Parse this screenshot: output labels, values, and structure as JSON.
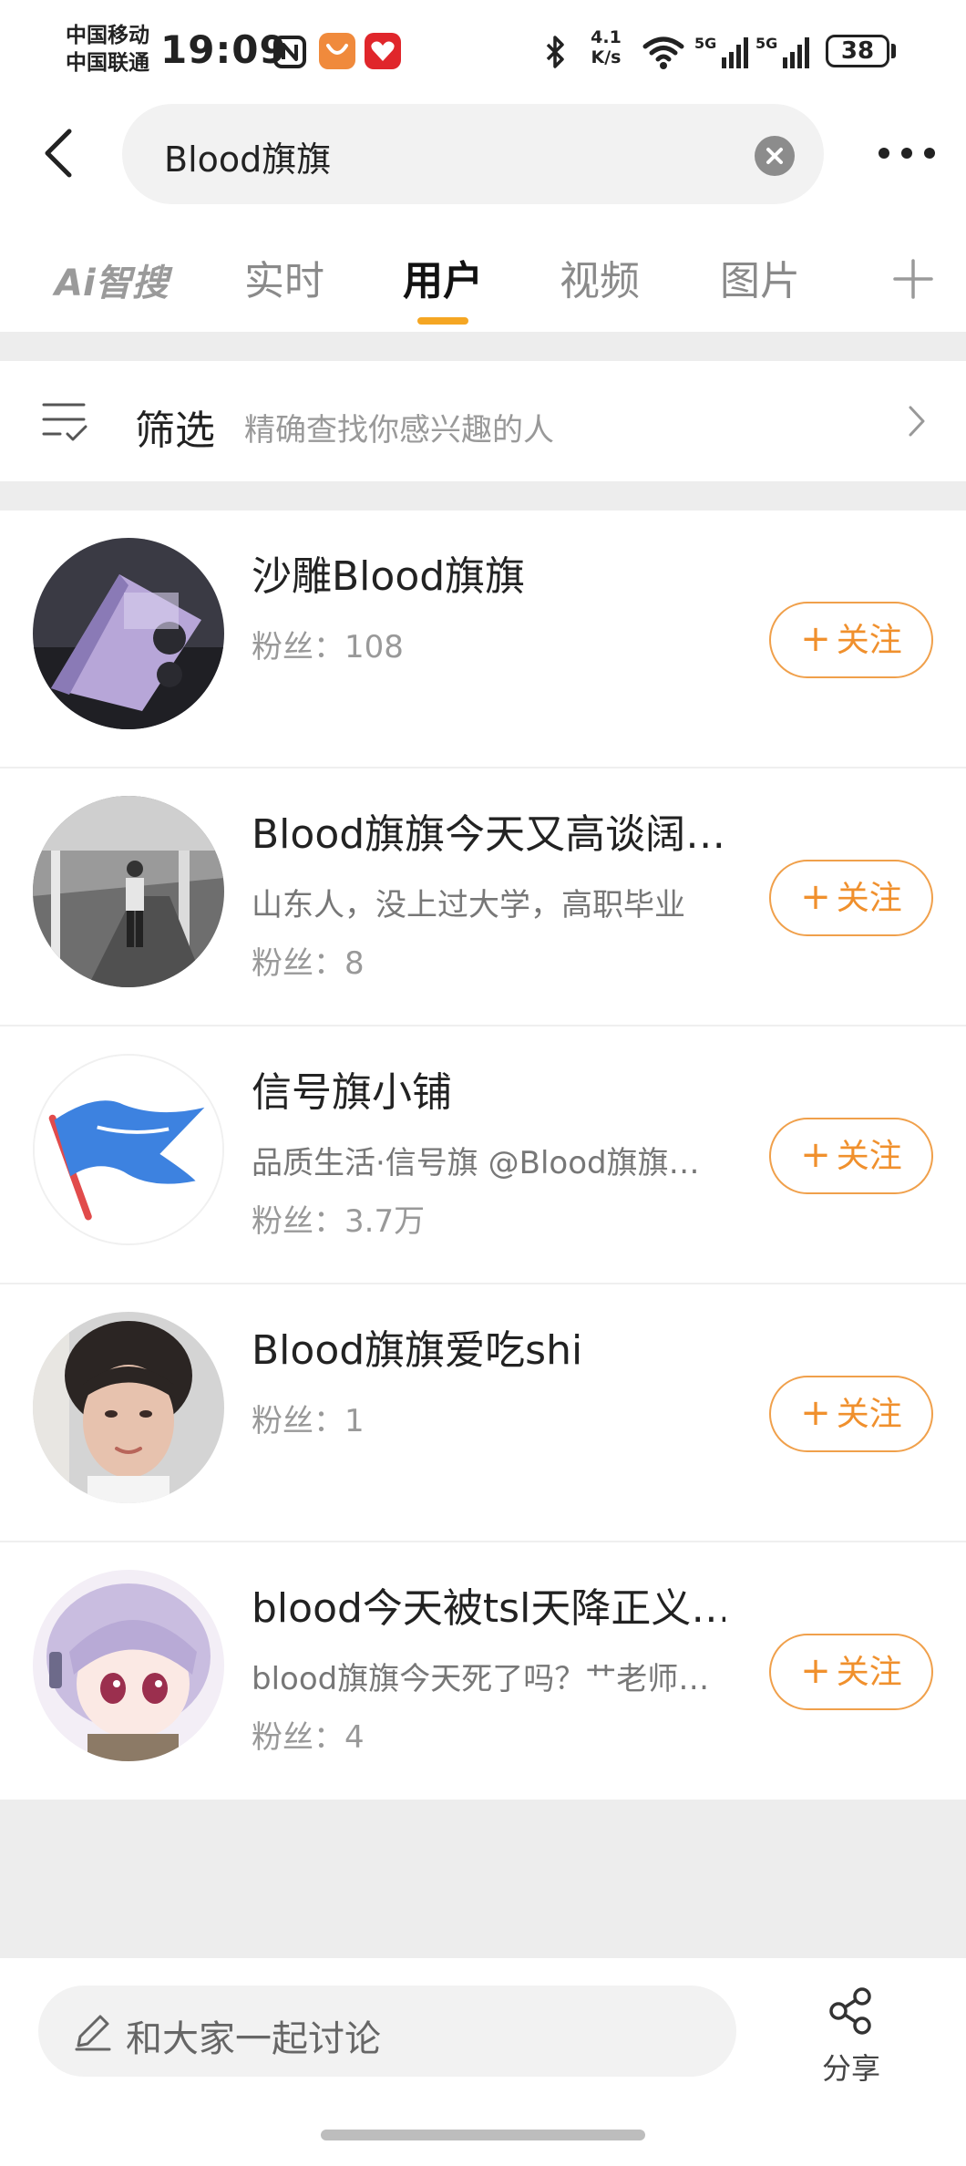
{
  "status_bar": {
    "carrier_1": "中国移动",
    "carrier_2": "中国联通",
    "time": "19:09",
    "net_speed_value": "4.1",
    "net_speed_unit": "K/s",
    "sig1_label": "5G",
    "sig2_label": "5G",
    "battery": "38"
  },
  "search": {
    "query": "Blood旗旗"
  },
  "tabs": [
    {
      "label": "Ai智搜"
    },
    {
      "label": "实时"
    },
    {
      "label": "用户"
    },
    {
      "label": "视频"
    },
    {
      "label": "图片"
    }
  ],
  "active_tab": "用户",
  "filter": {
    "title": "筛选",
    "description": "精确查找你感兴趣的人"
  },
  "users": [
    {
      "name": "沙雕Blood旗旗",
      "description": "",
      "fans_label": "粉丝：",
      "fans": "108",
      "follow_label": "关注"
    },
    {
      "name": "Blood旗旗今天又高谈阔…",
      "description": "山东人，没上过大学，高职毕业",
      "fans_label": "粉丝：",
      "fans": "8",
      "follow_label": "关注"
    },
    {
      "name": "信号旗小铺",
      "description": "品质生活·信号旗 @Blood旗旗…",
      "fans_label": "粉丝：",
      "fans": "3.7万",
      "follow_label": "关注"
    },
    {
      "name": "Blood旗旗爱吃shi",
      "description": "",
      "fans_label": "粉丝：",
      "fans": "1",
      "follow_label": "关注"
    },
    {
      "name": "blood今天被tsl天降正义…",
      "description": "blood旗旗今天死了吗？艹老师…",
      "fans_label": "粉丝：",
      "fans": "4",
      "follow_label": "关注"
    }
  ],
  "bottom": {
    "comment_placeholder": "和大家一起讨论",
    "share_label": "分享"
  },
  "colors": {
    "accent": "#f0902d",
    "tab_underline": "#f5a623",
    "background": "#ededed"
  },
  "icons": {
    "back": "back-arrow-icon",
    "clear": "clear-icon",
    "more": "more-dots-icon",
    "add_tab": "plus-icon",
    "filter": "filter-list-icon",
    "chevron": "chevron-right-icon",
    "pencil": "pencil-icon",
    "share": "share-icon"
  }
}
